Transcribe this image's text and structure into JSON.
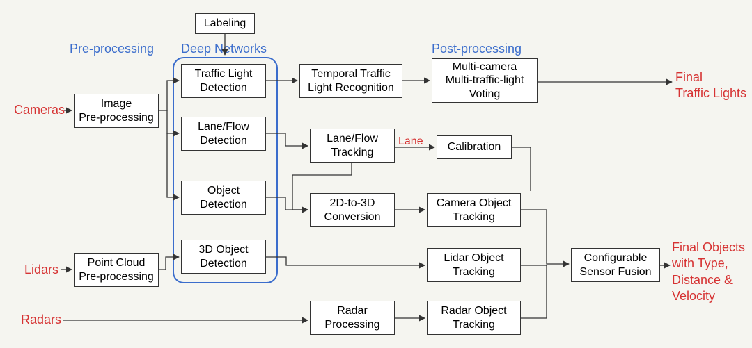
{
  "diagram": {
    "section_labels": {
      "preprocessing": "Pre-processing",
      "deepnetworks": "Deep Networks",
      "postprocessing": "Post-processing"
    },
    "inputs": {
      "cameras": "Cameras",
      "lidars": "Lidars",
      "radars": "Radars"
    },
    "outputs": {
      "traffic_lights": "Final\nTraffic Lights",
      "objects": "Final Objects\nwith Type,\nDistance &\nVelocity"
    },
    "boxes": {
      "labeling": "Labeling",
      "image_preproc": "Image\nPre-processing",
      "point_cloud_preproc": "Point Cloud\nPre-processing",
      "traffic_light_det": "Traffic Light\nDetection",
      "lane_flow_det": "Lane/Flow\nDetection",
      "object_det": "Object\nDetection",
      "three_d_object_det": "3D Object\nDetection",
      "temporal_traffic": "Temporal Traffic\nLight Recognition",
      "lane_flow_track": "Lane/Flow\nTracking",
      "two_d_to_three_d": "2D-to-3D\nConversion",
      "radar_proc": "Radar\nProcessing",
      "multi_camera_vote": "Multi-camera\nMulti-traffic-light\nVoting",
      "calibration": "Calibration",
      "camera_obj_track": "Camera Object\nTracking",
      "lidar_obj_track": "Lidar Object\nTracking",
      "radar_obj_track": "Radar Object\nTracking",
      "sensor_fusion": "Configurable\nSensor Fusion"
    },
    "edge_labels": {
      "lane": "Lane"
    }
  }
}
